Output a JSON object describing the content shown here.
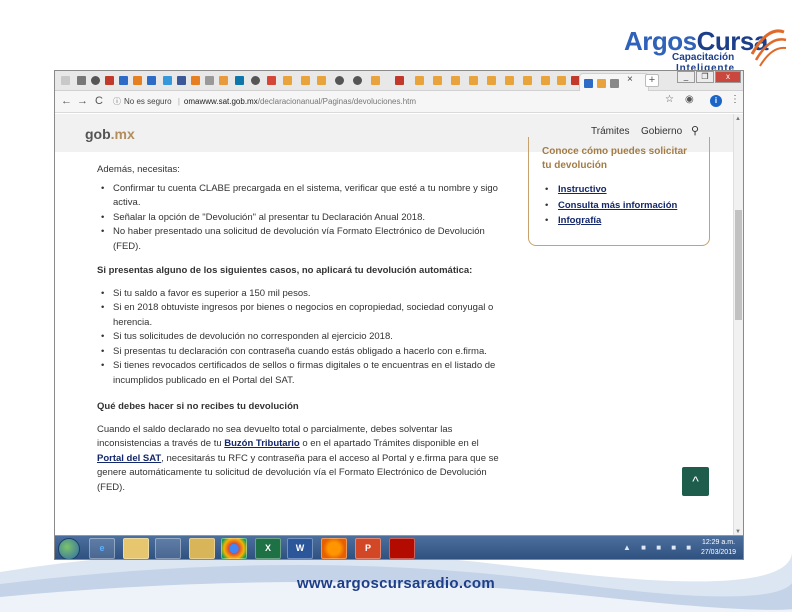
{
  "brand": {
    "logo_main": "Argos",
    "logo_accent": "Cursa",
    "tagline_1": "Capacitación",
    "tagline_2": "Inteligente",
    "footer_url": "www.argoscursaradio.com",
    "colors": {
      "brand_blue": "#1d3f8a",
      "brand_orange": "#e06a2a"
    }
  },
  "browser": {
    "active_tab_close": "×",
    "new_tab": "+",
    "window_buttons": [
      "_",
      "❐",
      "x"
    ],
    "nav": {
      "back": "←",
      "forward": "→",
      "reload": "C"
    },
    "address": {
      "security": "No es seguro",
      "separator": "|",
      "host": "omawww.sat.gob.mx",
      "path": "/declaracionanual/Paginas/devoluciones.htm"
    },
    "star": "☆",
    "extension_badge": "i",
    "menu": "⋮"
  },
  "site": {
    "logo_gob": "gob",
    "logo_mx": ".mx",
    "nav": [
      "Trámites",
      "Gobierno"
    ],
    "search_icon": "search-icon"
  },
  "sidebox": {
    "title_line1": "Conoce cómo puedes solicitar",
    "title_line2": "tu devolución",
    "links": [
      "Instructivo",
      "Consulta más información",
      "Infografía"
    ]
  },
  "content": {
    "intro": "Además, necesitas:",
    "needs": [
      "Confirmar tu cuenta CLABE precargada en el sistema, verificar que esté a tu nombre y sigo activa.",
      "Señalar la opción de \"Devolución\" al presentar tu Declaración Anual 2018.",
      "No haber presentado una solicitud de devolución vía Formato Electrónico de Devolución (FED)."
    ],
    "heading_cases": "Si presentas alguno de los siguientes casos, no aplicará tu devolución automática:",
    "cases": [
      "Si tu saldo a favor es superior a 150 mil pesos.",
      "Si en 2018 obtuviste ingresos por bienes o negocios en copropiedad, sociedad conyugal o herencia.",
      "Si tus solicitudes de devolución no corresponden al ejercicio 2018.",
      "Si presentas tu declaración con contraseña cuando estás obligado a hacerlo con e.firma.",
      "Si tienes revocados certificados de sellos o firmas digitales o te encuentras en el listado de incumplidos publicado en el Portal del SAT."
    ],
    "heading_no_refund": "Qué debes hacer si no recibes tu devolución",
    "para_1": "Cuando el saldo declarado no sea devuelto total o parcialmente, debes solventar las inconsistencias a través de tu ",
    "link_buzon": "Buzón Tributario",
    "para_2": " o en el apartado Trámites disponible en el ",
    "link_portal": "Portal del SAT",
    "para_3": ", necesitarás tu RFC y contraseña para el acceso al Portal y e.firma para que se genere automáticamente tu solicitud de devolución vía el Formato Electrónico de Devolución (FED).",
    "back_to_top": "^"
  },
  "taskbar": {
    "items": [
      "ie-icon",
      "explorer-icon",
      "media-icon",
      "player-icon",
      "chrome-icon",
      "excel-icon",
      "word-icon",
      "firefox-icon",
      "powerpoint-icon",
      "acrobat-icon"
    ],
    "labels": [
      "e",
      "",
      "",
      "",
      "",
      "X",
      "W",
      "",
      "P",
      ""
    ],
    "clock_time": "12:29 a.m.",
    "clock_date": "27/03/2019"
  }
}
